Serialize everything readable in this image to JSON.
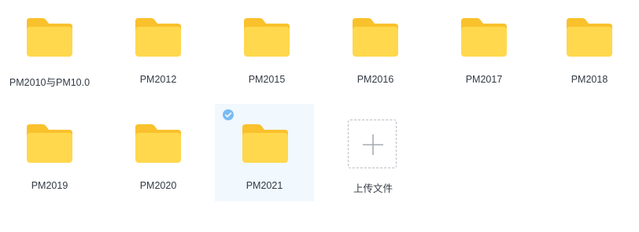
{
  "folders": [
    {
      "name": "PM2010与PM10.0",
      "selected": false
    },
    {
      "name": "PM2012",
      "selected": false
    },
    {
      "name": "PM2015",
      "selected": false
    },
    {
      "name": "PM2016",
      "selected": false
    },
    {
      "name": "PM2017",
      "selected": false
    },
    {
      "name": "PM2018",
      "selected": false
    },
    {
      "name": "PM2019",
      "selected": false
    },
    {
      "name": "PM2020",
      "selected": false
    },
    {
      "name": "PM2021",
      "selected": true
    }
  ],
  "upload": {
    "label": "上传文件"
  },
  "icons": {
    "folder": "folder-icon",
    "check": "check-circle-icon",
    "upload": "plus-icon"
  },
  "colors": {
    "folder_front": "#ffd84d",
    "folder_back": "#f9c12c",
    "selected_bg": "#f1f8fe",
    "check": "#7bbcf5"
  }
}
